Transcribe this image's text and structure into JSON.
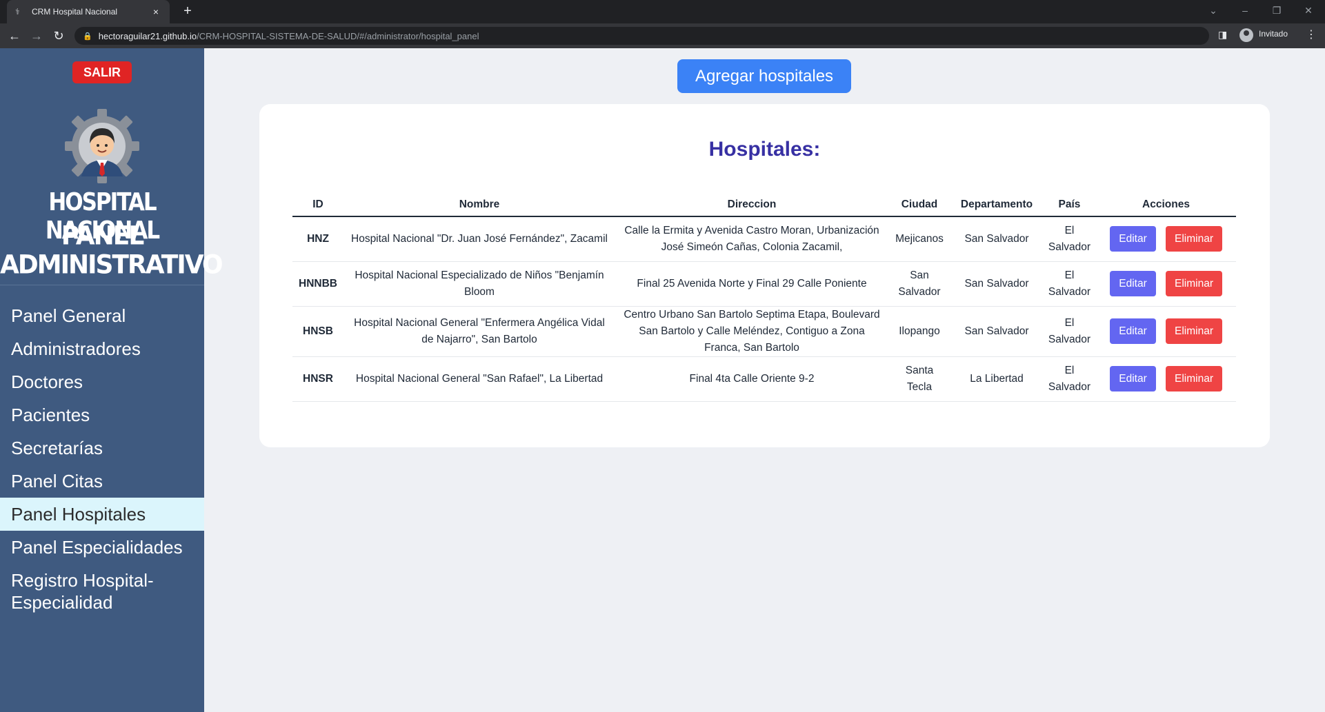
{
  "browser": {
    "tab_title": "CRM Hospital Nacional",
    "url_host": "hectoraguilar21.github.io",
    "url_path": "/CRM-HOSPITAL-SISTEMA-DE-SALUD/#/administrator/hospital_panel",
    "profile_label": "Invitado"
  },
  "sidebar": {
    "logout_label": "SALIR",
    "brand_line1": "HOSPITAL NACIONAL",
    "brand_line2": "PANEL",
    "brand_line3": "ADMINISTRATIVO",
    "items": [
      {
        "label": "Panel General"
      },
      {
        "label": "Administradores"
      },
      {
        "label": "Doctores"
      },
      {
        "label": "Pacientes"
      },
      {
        "label": "Secretarías"
      },
      {
        "label": "Panel Citas"
      },
      {
        "label": "Panel Hospitales"
      },
      {
        "label": "Panel Especialidades"
      },
      {
        "label": "Registro Hospital-Especialidad"
      }
    ],
    "active_item": "Panel Hospitales"
  },
  "main": {
    "add_button_label": "Agregar hospitales",
    "title": "Hospitales:",
    "columns": [
      "ID",
      "Nombre",
      "Direccion",
      "Ciudad",
      "Departamento",
      "País",
      "Acciones"
    ],
    "edit_label": "Editar",
    "delete_label": "Eliminar",
    "rows": [
      {
        "id": "HNZ",
        "nombre": "Hospital Nacional \"Dr. Juan José Fernández\", Zacamil",
        "direccion": "Calle la Ermita y Avenida Castro Moran, Urbanización José Simeón Cañas, Colonia Zacamil,",
        "ciudad": "Mejicanos",
        "departamento": "San Salvador",
        "pais": "El Salvador"
      },
      {
        "id": "HNNBB",
        "nombre": "Hospital Nacional Especializado de Niños \"Benjamín Bloom",
        "direccion": "Final 25 Avenida Norte y Final 29 Calle Poniente",
        "ciudad": "San Salvador",
        "departamento": "San Salvador",
        "pais": "El Salvador"
      },
      {
        "id": "HNSB",
        "nombre": "Hospital Nacional General \"Enfermera Angélica Vidal de Najarro\", San Bartolo",
        "direccion": "Centro Urbano San Bartolo Septima Etapa, Boulevard San Bartolo y Calle Meléndez, Contiguo a Zona Franca, San Bartolo",
        "ciudad": "Ilopango",
        "departamento": "San Salvador",
        "pais": "El Salvador"
      },
      {
        "id": "HNSR",
        "nombre": "Hospital Nacional General \"San Rafael\", La Libertad",
        "direccion": "Final 4ta Calle Oriente 9-2",
        "ciudad": "Santa Tecla",
        "departamento": "La Libertad",
        "pais": "El Salvador"
      }
    ]
  }
}
